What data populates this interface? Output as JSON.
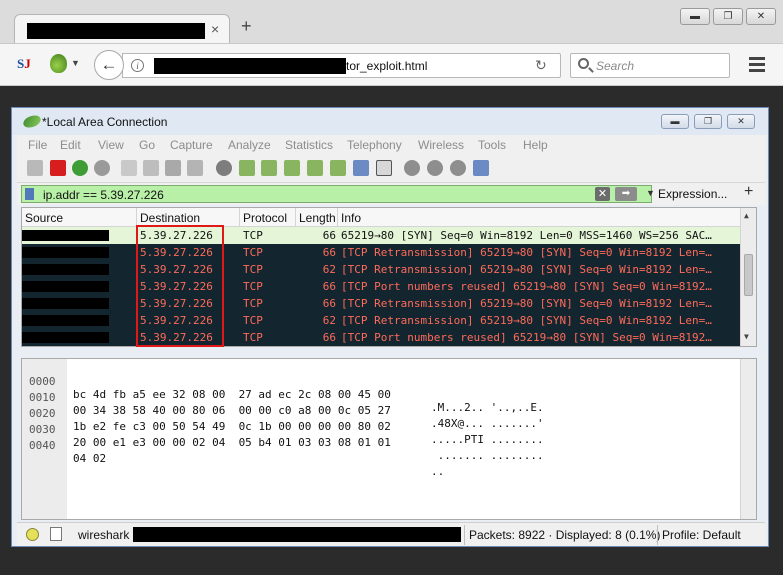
{
  "browser": {
    "new_tab_label": "+",
    "tab_close_label": "×",
    "url_suffix": "tor_exploit.html",
    "search_placeholder": "Search",
    "info_label": "i",
    "back_label": "←",
    "reload_label": "↻",
    "window_controls": [
      "▬",
      "❐",
      "✕"
    ]
  },
  "wireshark": {
    "title": "*Local Area Connection",
    "window_controls": [
      "▬",
      "❐",
      "✕"
    ],
    "menu": [
      "File",
      "Edit",
      "View",
      "Go",
      "Capture",
      "Analyze",
      "Statistics",
      "Telephony",
      "Wireless",
      "Tools",
      "Help"
    ],
    "filter": {
      "value": "ip.addr == 5.39.27.226",
      "expression_label": "Expression...",
      "add_label": "+"
    },
    "packet_list": {
      "columns": [
        "Source",
        "Destination",
        "Protocol",
        "Length",
        "Info"
      ],
      "rows": [
        {
          "destination": "5.39.27.226",
          "protocol": "TCP",
          "length": "66",
          "info": "65219→80 [SYN] Seq=0 Win=8192 Len=0 MSS=1460 WS=256 SAC…",
          "style": "selected"
        },
        {
          "destination": "5.39.27.226",
          "protocol": "TCP",
          "length": "66",
          "info": "[TCP Retransmission] 65219→80 [SYN] Seq=0 Win=8192 Len=…",
          "style": "error"
        },
        {
          "destination": "5.39.27.226",
          "protocol": "TCP",
          "length": "62",
          "info": "[TCP Retransmission] 65219→80 [SYN] Seq=0 Win=8192 Len=…",
          "style": "error"
        },
        {
          "destination": "5.39.27.226",
          "protocol": "TCP",
          "length": "66",
          "info": "[TCP Port numbers reused] 65219→80 [SYN] Seq=0 Win=8192…",
          "style": "error"
        },
        {
          "destination": "5.39.27.226",
          "protocol": "TCP",
          "length": "66",
          "info": "[TCP Retransmission] 65219→80 [SYN] Seq=0 Win=8192 Len=…",
          "style": "error"
        },
        {
          "destination": "5.39.27.226",
          "protocol": "TCP",
          "length": "62",
          "info": "[TCP Retransmission] 65219→80 [SYN] Seq=0 Win=8192 Len=…",
          "style": "error"
        },
        {
          "destination": "5.39.27.226",
          "protocol": "TCP",
          "length": "66",
          "info": "[TCP Port numbers reused] 65219→80 [SYN] Seq=0 Win=8192…",
          "style": "error"
        }
      ]
    },
    "bytes": [
      {
        "offset": "0000",
        "hex": "bc 4d fb a5 ee 32 08 00  27 ad ec 2c 08 00 45 00",
        "ascii": ".M...2.. '..,..E."
      },
      {
        "offset": "0010",
        "hex": "00 34 38 58 40 00 80 06  00 00 c0 a8 00 0c 05 27",
        "ascii": ".48X@... .......'"
      },
      {
        "offset": "0020",
        "hex": "1b e2 fe c3 00 50 54 49  0c 1b 00 00 00 00 80 02",
        "ascii": ".....PTI ........"
      },
      {
        "offset": "0030",
        "hex": "20 00 e1 e3 00 00 02 04  05 b4 01 03 03 08 01 01",
        "ascii": " ....... ........"
      },
      {
        "offset": "0040",
        "hex": "04 02",
        "ascii": ".."
      }
    ],
    "status": {
      "file_label": "wireshark",
      "packets_text": "Packets: 8922 · Displayed: 8 (0.1%)",
      "profile_text": "Profile: Default"
    }
  },
  "colors": {
    "row_selected": "#e4f5d8",
    "row_error_bg": "#13262f",
    "row_error_fg": "#ff6a5a",
    "filter_valid": "#b9f0a8",
    "highlight_box": "#e01818"
  }
}
